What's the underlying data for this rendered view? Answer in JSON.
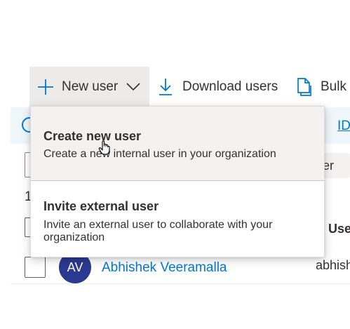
{
  "toolbar": {
    "new_user_label": "New user",
    "download_label": "Download users",
    "bulk_label": "Bulk"
  },
  "banner": {
    "link_text": "ID."
  },
  "filters": {
    "pill_text": "er"
  },
  "list": {
    "count_text": "1",
    "column_header": "Use",
    "rows": [
      {
        "initials": "AV",
        "name": "Abhishek Veeramalla",
        "upn": "abhish"
      }
    ]
  },
  "menu": {
    "items": [
      {
        "title": "Create new user",
        "description": "Create a new internal user in your organization"
      },
      {
        "title": "Invite external user",
        "description": "Invite an external user to collaborate with your organization"
      }
    ]
  },
  "colors": {
    "accent": "#0078d4",
    "avatar_bg": "#2b3990",
    "toolbar_active_bg": "#edebe9"
  }
}
